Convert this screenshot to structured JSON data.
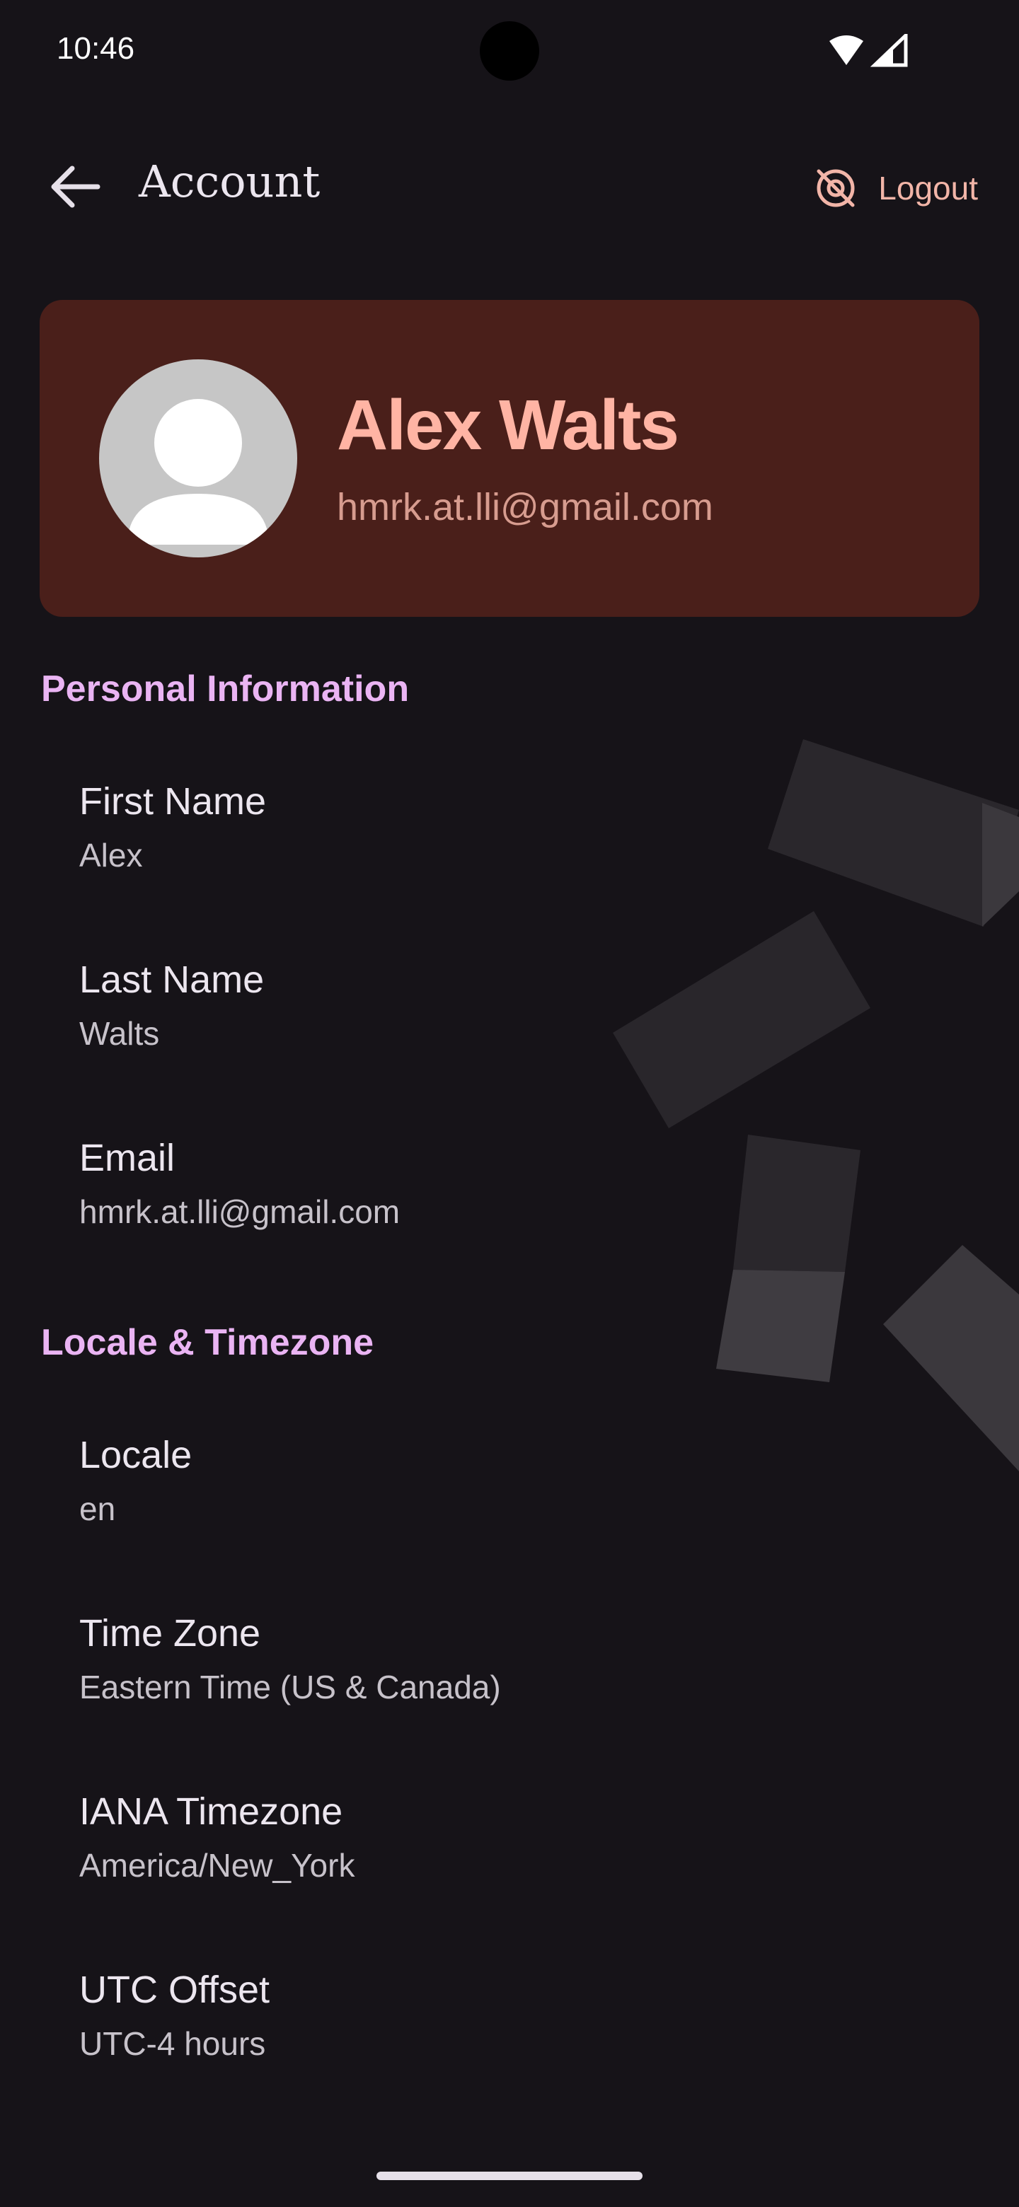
{
  "status_bar": {
    "time": "10:46"
  },
  "app_bar": {
    "title": "Account",
    "logout_label": "Logout"
  },
  "profile": {
    "name": "Alex Walts",
    "email": "hmrk.at.lli@gmail.com"
  },
  "sections": {
    "personal": {
      "title": "Personal Information",
      "fields": [
        {
          "label": "First Name",
          "value": "Alex"
        },
        {
          "label": "Last Name",
          "value": "Walts"
        },
        {
          "label": "Email",
          "value": "hmrk.at.lli@gmail.com"
        }
      ]
    },
    "locale": {
      "title": "Locale & Timezone",
      "fields": [
        {
          "label": "Locale",
          "value": "en"
        },
        {
          "label": "Time Zone",
          "value": "Eastern Time (US & Canada)"
        },
        {
          "label": "IANA Timezone",
          "value": "America/New_York"
        },
        {
          "label": "UTC Offset",
          "value": "UTC-4 hours"
        }
      ]
    }
  },
  "icons": {
    "back": "arrow-back-icon",
    "logout": "location-off-icon",
    "wifi": "wifi-icon",
    "signal": "cell-signal-icon",
    "avatar": "person-icon"
  },
  "colors": {
    "background": "#161318",
    "card": "#4a1f1a",
    "accent_name": "#ffb4a4",
    "section_title": "#eab4f3",
    "logout": "#f2b5a8"
  }
}
